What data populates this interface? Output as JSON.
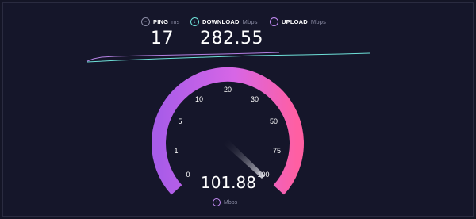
{
  "stats": {
    "ping": {
      "label": "PING",
      "unit": "ms",
      "value": "17",
      "icon": "ping-icon"
    },
    "download": {
      "label": "DOWNLOAD",
      "unit": "Mbps",
      "value": "282.55",
      "icon": "download-arrow-icon"
    },
    "upload": {
      "label": "UPLOAD",
      "unit": "Mbps",
      "value": "",
      "icon": "upload-arrow-icon"
    }
  },
  "gauge": {
    "ticks": [
      "0",
      "1",
      "5",
      "10",
      "20",
      "30",
      "50",
      "75",
      "100"
    ],
    "current_value": "101.88",
    "unit": "Mbps",
    "unit_icon": "upload-arrow-icon"
  },
  "colors": {
    "background": "#15162a",
    "download": "#6ee0d8",
    "upload": "#c58cf6",
    "gauge_start": "#b267f2",
    "gauge_end": "#ff5fa2"
  }
}
